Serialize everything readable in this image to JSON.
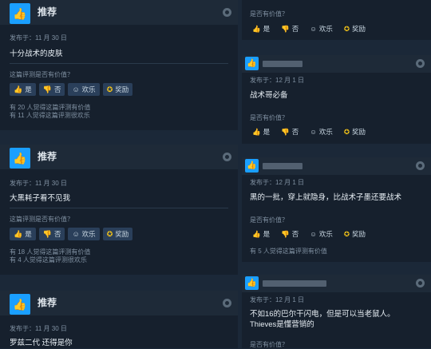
{
  "left_reviews": [
    {
      "recommend": "推荐",
      "date": "发布于：11 月 30 日",
      "text": "十分战术的皮肤",
      "helpful_q": "这篇评测是否有价值？",
      "yes": "是",
      "no": "否",
      "funny": "欢乐",
      "award": "奖励",
      "count1": "有 20 人觉得这篇评测有价值",
      "count2": "有 11 人觉得这篇评测很欢乐"
    },
    {
      "recommend": "推荐",
      "date": "发布于：11 月 30 日",
      "text": "大黑耗子看不见我",
      "helpful_q": "这篇评测是否有价值？",
      "yes": "是",
      "no": "否",
      "funny": "欢乐",
      "award": "奖励",
      "count1": "有 18 人觉得这篇评测有价值",
      "count2": "有 4 人觉得这篇评测很欢乐"
    },
    {
      "recommend": "推荐",
      "date": "发布于：11 月 30 日",
      "text": "罗兹二代 还得是你"
    }
  ],
  "right_reviews": [
    {
      "helpful_q": "是否有价值？",
      "yes": "是",
      "no": "否",
      "funny": "欢乐",
      "award": "奖励"
    },
    {
      "date": "发布于：12 月 1 日",
      "text": "战术哥必备",
      "helpful_q": "是否有价值？",
      "yes": "是",
      "no": "否",
      "funny": "欢乐",
      "award": "奖励"
    },
    {
      "date": "发布于：12 月 1 日",
      "text": "黑的一批，穿上就隐身，比战术子墨还要战术",
      "helpful_q": "是否有价值？",
      "yes": "是",
      "no": "否",
      "funny": "欢乐",
      "award": "奖励",
      "count1": "有 5 人觉得这篇评测有价值"
    },
    {
      "date": "发布于：12 月 1 日",
      "text1": "不如16的巴尔干闪电，但是可以当老鼠人。",
      "text2": "Thieves是懂营销的",
      "helpful_q": "是否有价值？"
    }
  ]
}
